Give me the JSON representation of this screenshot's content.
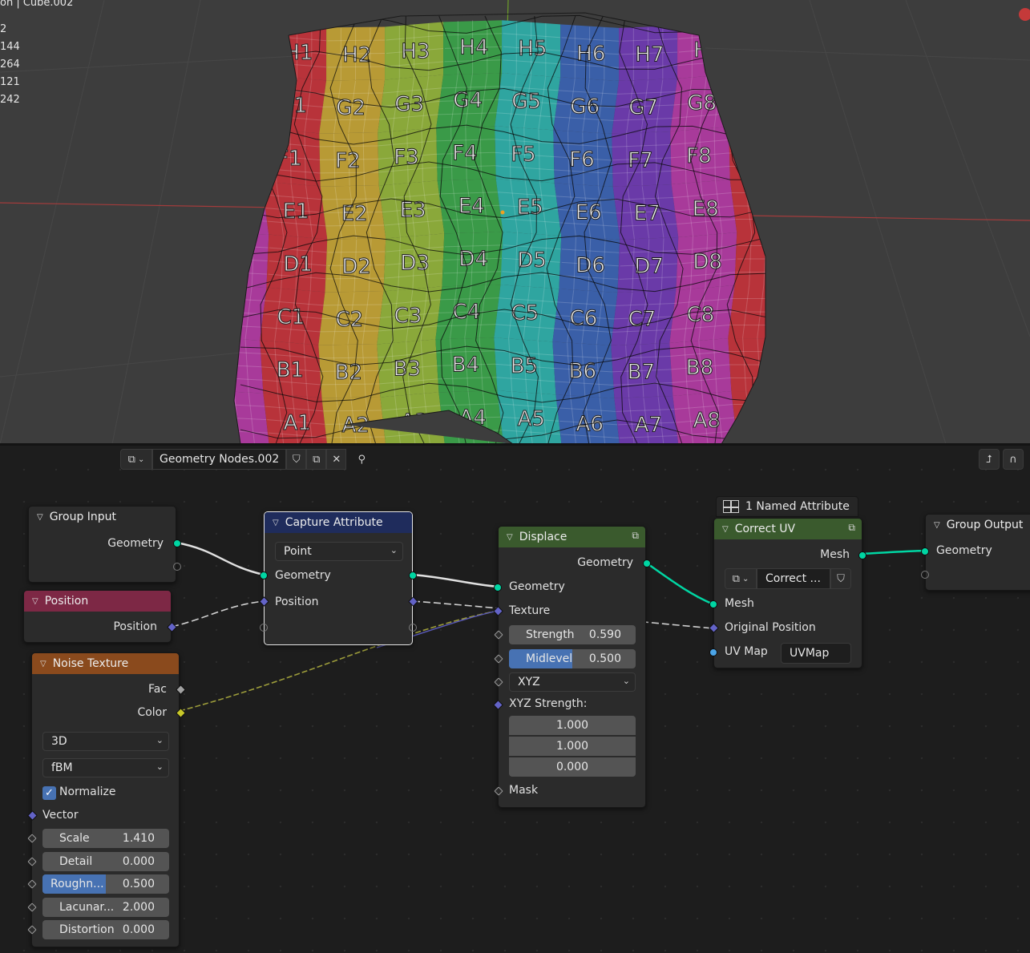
{
  "viewport": {
    "header_text": "on | Cube.002",
    "stats": [
      "2",
      "144",
      "264",
      "121",
      "242"
    ],
    "grid_rows": [
      "H",
      "G",
      "F",
      "E",
      "D",
      "C",
      "B",
      "A"
    ],
    "grid_cols": [
      "1",
      "2",
      "3",
      "4",
      "5",
      "6",
      "7",
      "8"
    ],
    "edge_labels": [
      "8",
      "B",
      "8",
      "3",
      "D",
      "C"
    ]
  },
  "editor": {
    "node_tree_name": "Geometry Nodes.002"
  },
  "nodes": {
    "group_input": {
      "title": "Group Input",
      "out_geometry": "Geometry"
    },
    "position": {
      "title": "Position",
      "out_position": "Position"
    },
    "capture": {
      "title": "Capture Attribute",
      "domain": "Point",
      "in_geometry": "Geometry",
      "in_position": "Position"
    },
    "noise": {
      "title": "Noise Texture",
      "out_fac": "Fac",
      "out_color": "Color",
      "dimensions": "3D",
      "type": "fBM",
      "normalize_label": "Normalize",
      "normalize_checked": true,
      "vector_label": "Vector",
      "fields": [
        {
          "label": "Scale",
          "value": "1.410",
          "fill": 0
        },
        {
          "label": "Detail",
          "value": "0.000",
          "fill": 0
        },
        {
          "label": "Roughn...",
          "value": "0.500",
          "fill": 0.5
        },
        {
          "label": "Lacunar...",
          "value": "2.000",
          "fill": 0
        },
        {
          "label": "Distortion",
          "value": "0.000",
          "fill": 0
        }
      ]
    },
    "displace": {
      "title": "Displace",
      "out_geometry": "Geometry",
      "in_geometry": "Geometry",
      "in_texture": "Texture",
      "strength_label": "Strength",
      "strength_value": "0.590",
      "midlevel_label": "Midlevel",
      "midlevel_value": "0.500",
      "midlevel_fill": 0.5,
      "mode": "XYZ",
      "xyz_strength_label": "XYZ Strength:",
      "xyz": [
        "1.000",
        "1.000",
        "0.000"
      ],
      "mask_label": "Mask"
    },
    "correct_uv": {
      "attr_tag": "1 Named Attribute",
      "title": "Correct UV",
      "out_mesh": "Mesh",
      "group_name": "Correct ...",
      "in_mesh": "Mesh",
      "in_original_position": "Original Position",
      "uv_map_label": "UV Map",
      "uv_map_value": "UVMap"
    },
    "group_output": {
      "title": "Group Output",
      "in_geometry": "Geometry"
    }
  },
  "colors": {
    "geometry_socket": "#00d6a3",
    "vector_socket": "#6363c7",
    "color_socket": "#c7c729",
    "input_header": "#7d2845",
    "texture_header": "#8a4a1d",
    "geometry_header": "#3a5a2d",
    "attribute_header": "#1f2c5c",
    "group_header": "#2b2b2b",
    "accent": "#4772b3"
  }
}
